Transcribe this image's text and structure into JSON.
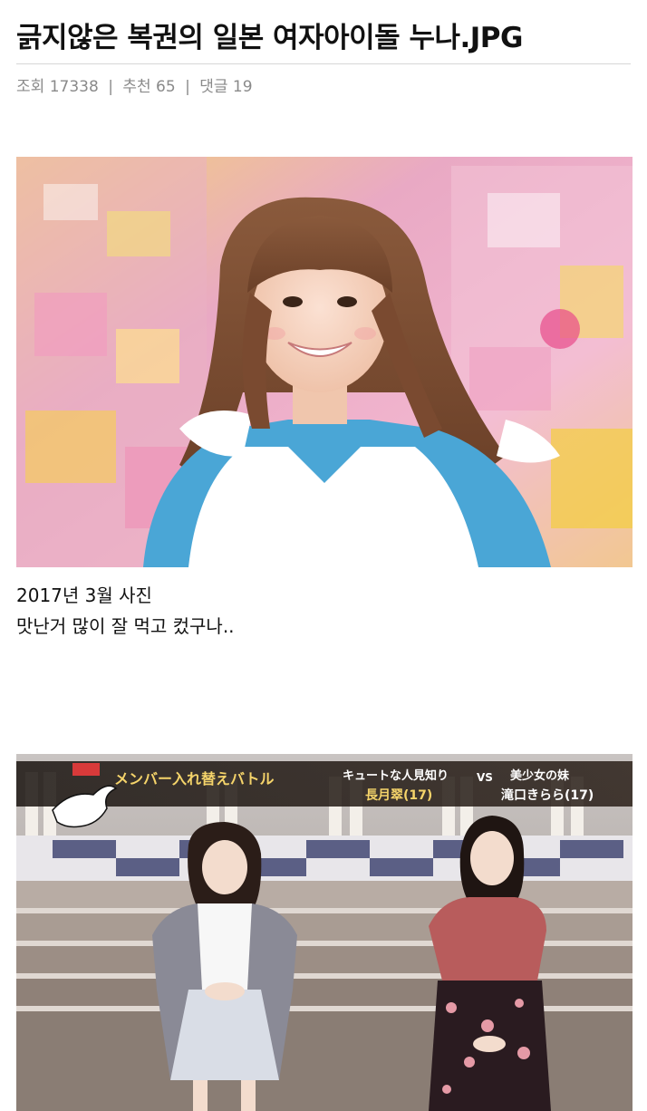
{
  "post": {
    "title": "긁지않은 복권의 일본 여자아이돌 누나.JPG",
    "meta": {
      "views_label": "조회",
      "views": "17338",
      "recommend_label": "추천",
      "recommend": "65",
      "comments_label": "댓글",
      "comments": "19",
      "separator": "|"
    },
    "body": {
      "caption_line1": "2017년 3월 사진",
      "caption_line2": "맛난거 많이 잘 먹고 컸구나.."
    },
    "images": {
      "tv_banner_left": "メンバー入れ替えバトル",
      "tv_banner_mid": "キュートな人見知り",
      "tv_banner_name_left": "長月翠(17)",
      "tv_banner_vs": "VS",
      "tv_banner_right": "美少女の妹",
      "tv_banner_name_right": "滝口きらら(17)"
    }
  },
  "colors": {
    "title": "#111111",
    "meta": "#8a8a8a",
    "rule": "#d6d6d6"
  }
}
